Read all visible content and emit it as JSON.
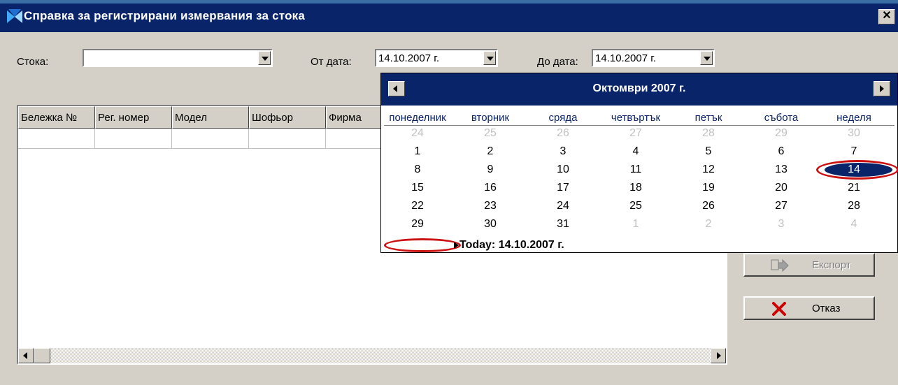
{
  "window": {
    "title": "Справка за регистрирани измервания за стока",
    "close_label": "✕"
  },
  "filters": {
    "product_label": "Стока:",
    "product_value": "",
    "from_label": "От дата:",
    "from_value": "14.10.2007 г.",
    "to_label": "До дата:",
    "to_value": "14.10.2007 г."
  },
  "grid": {
    "columns": [
      "Бележка №",
      "Рег. номер",
      "Модел",
      "Шофьор",
      "Фирма"
    ]
  },
  "buttons": {
    "export_label": "Експорт",
    "cancel_label": "Отказ"
  },
  "calendar": {
    "month_title": "Октомври 2007 г.",
    "weekdays": [
      "понеделник",
      "вторник",
      "сряда",
      "четвъртък",
      "петък",
      "събота",
      "неделя"
    ],
    "weeks": [
      [
        "24",
        "25",
        "26",
        "27",
        "28",
        "29",
        "30"
      ],
      [
        "1",
        "2",
        "3",
        "4",
        "5",
        "6",
        "7"
      ],
      [
        "8",
        "9",
        "10",
        "11",
        "12",
        "13",
        "14"
      ],
      [
        "15",
        "16",
        "17",
        "18",
        "19",
        "20",
        "21"
      ],
      [
        "22",
        "23",
        "24",
        "25",
        "26",
        "27",
        "28"
      ],
      [
        "29",
        "30",
        "31",
        "1",
        "2",
        "3",
        "4"
      ]
    ],
    "selected_day": "14",
    "today_label": "Today: 14.10.2007 г."
  },
  "colors": {
    "titlebar": "#0a246a",
    "window_bg": "#d4d0c8",
    "annotation": "#cc1111",
    "cancel_icon": "#cc0000"
  }
}
